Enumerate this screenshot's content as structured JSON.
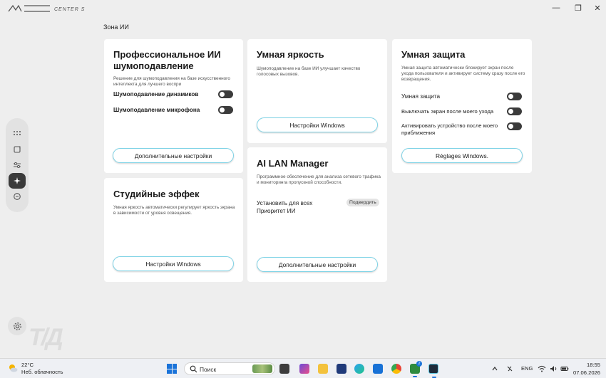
{
  "window": {
    "logo_text": "MSI CENTER S",
    "controls": {
      "minimize": "—",
      "maximize": "❐",
      "close": "✕"
    }
  },
  "page_title": "Зона ИИ",
  "sidebar": {
    "items": [
      {
        "icon": "grid-icon"
      },
      {
        "icon": "bookmark-icon"
      },
      {
        "icon": "sliders-icon"
      },
      {
        "icon": "ai-sparkle-icon",
        "active": true
      },
      {
        "icon": "chat-support-icon"
      }
    ],
    "settings_icon": "gear-icon"
  },
  "cards": {
    "noise": {
      "title_line1": "Профессиональное ИИ",
      "title_line2": "шумоподавление",
      "desc_line1": "Решение для шумоподавления на базе искусственного",
      "desc_line2": "интеллекта для лучшего воспри",
      "row1": "Шумоподавление динамиков",
      "row2": "Шумоподавление микрофона",
      "button": "Дополнительные настройки"
    },
    "brightness": {
      "title": "Умная яркость",
      "desc_line1": "Шумоподавление на базе ИИ улучшает качество",
      "desc_line2": "голосовых вызовов.",
      "button": "Настройки Windows"
    },
    "protection": {
      "title": "Умная защита",
      "desc_line1": "Умная защита автоматически блокирует экран после",
      "desc_line2": "ухода пользователя и активирует систему сразу после его",
      "desc_line3": "возвращения.",
      "row1": "Умная защита",
      "row2": "Выключать экран после моего ухода",
      "row3_line1": "Активировать устройство после моего",
      "row3_line2": "приближения",
      "button": "Réglages Windows."
    },
    "studio": {
      "title": "Студийные эффек",
      "desc_line1": "Умная яркость автоматически регулирует яркость экрана",
      "desc_line2": "в зависимости от уровня освещения.",
      "button": "Настройки Windows"
    },
    "lan": {
      "title": "AI LAN Manager",
      "desc_line1": "Программное обеспечение для анализа сетевого трафика",
      "desc_line2": "и мониторинга пропускной способности.",
      "row_line1": "Установить для всех",
      "row_line2": "Приоритет ИИ",
      "confirm": "Подвердить",
      "button": "Дополнительные настройки"
    }
  },
  "taskbar": {
    "weather_temp": "22°C",
    "weather_desc": "Неб. облачность",
    "search_placeholder": "Поиск",
    "lang": "ENG",
    "time": "18:55",
    "date": "07.06.2026",
    "badge_count": "2"
  },
  "colors": {
    "accent": "#7fd3e6",
    "toggle": "#3b3b3b",
    "card": "#ffffff",
    "background": "#eeeeee"
  }
}
